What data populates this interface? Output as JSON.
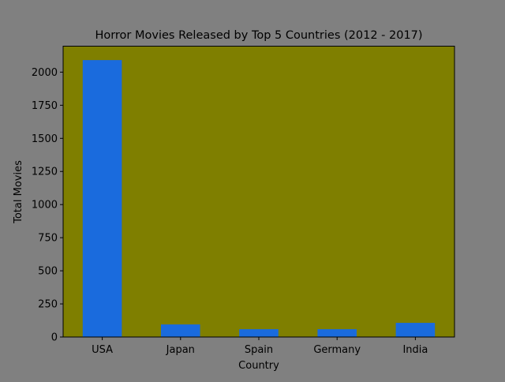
{
  "chart_data": {
    "type": "bar",
    "title": "Horror Movies Released by Top 5 Countries (2012 - 2017)",
    "xlabel": "Country",
    "ylabel": "Total Movies",
    "categories": [
      "USA",
      "Japan",
      "Spain",
      "Germany",
      "India"
    ],
    "values": [
      2091,
      95,
      59,
      59,
      107
    ],
    "ylim": [
      0,
      2196
    ],
    "yticks": [
      0,
      250,
      500,
      750,
      1000,
      1250,
      1500,
      1750,
      2000
    ],
    "grid": false,
    "colors": {
      "bar": "#1a6bdd",
      "plot_bg": "#7f7f00",
      "figure_bg": "#808080"
    }
  }
}
